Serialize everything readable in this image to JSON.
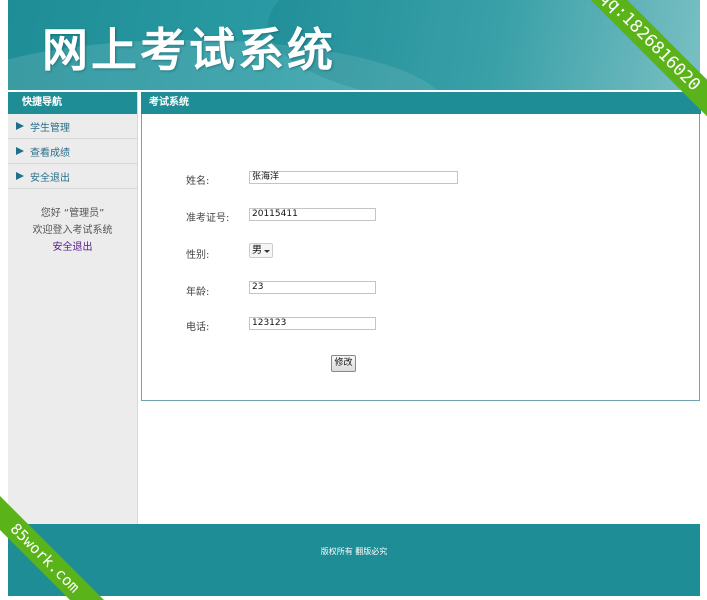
{
  "header": {
    "title": "网上考试系统"
  },
  "watermarks": {
    "top_right": "qq:1826816020",
    "bottom_left": "85work.com"
  },
  "sidebar": {
    "title": "快捷导航",
    "items": [
      {
        "label": "学生管理"
      },
      {
        "label": "查看成绩"
      },
      {
        "label": "安全退出"
      }
    ],
    "greeting_line1": "您好 “管理员”",
    "greeting_line2": "欢迎登入考试系统",
    "logout_link": "安全退出"
  },
  "main": {
    "title": "考试系统",
    "form": {
      "name_label": "姓名:",
      "name_value": "张海洋",
      "ticket_label": "准考证号:",
      "ticket_value": "20115411",
      "gender_label": "性别:",
      "gender_value": "男",
      "age_label": "年龄:",
      "age_value": "23",
      "phone_label": "电话:",
      "phone_value": "123123",
      "submit_label": "修改"
    }
  },
  "footer": {
    "text": "版权所有 翻版必究"
  },
  "colors": {
    "primary": "#1f8d96",
    "sidebar_bg": "#ececec",
    "ribbon": "#5bb31a"
  }
}
